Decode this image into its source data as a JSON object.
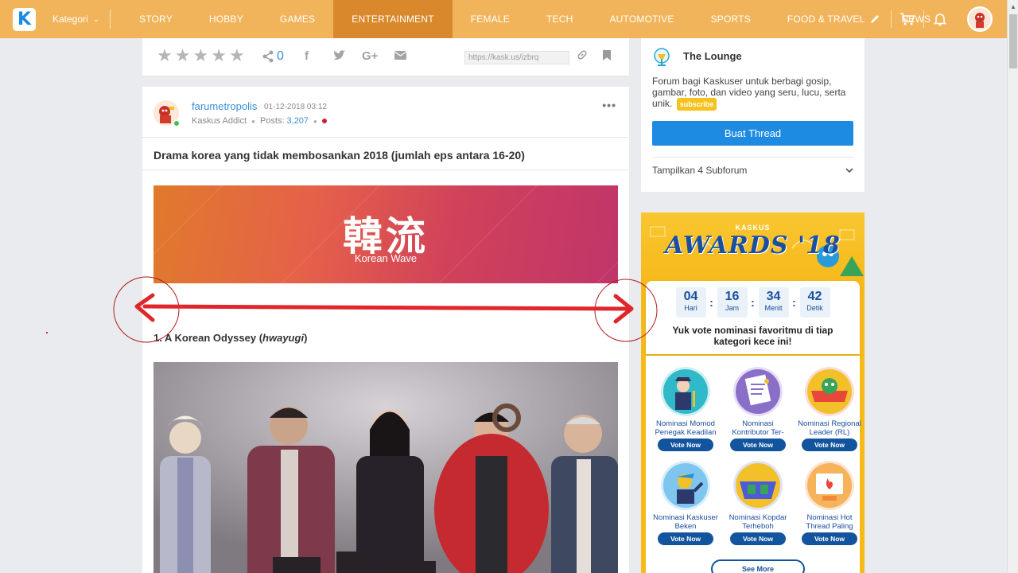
{
  "nav": {
    "logo_letter": "K",
    "kategori_label": "Kategori",
    "items": [
      "STORY",
      "HOBBY",
      "GAMES",
      "ENTERTAINMENT",
      "FEMALE",
      "TECH",
      "AUTOMOTIVE",
      "SPORTS",
      "FOOD & TRAVEL",
      "NEWS"
    ],
    "active_item": "ENTERTAINMENT",
    "accent_color": "#f2b45a",
    "active_color": "#d9892c"
  },
  "actionbar": {
    "share_count": "0",
    "short_url": "https://kask.us/izbrq"
  },
  "post": {
    "username": "farumetropolis",
    "date": "01-12-2018 03:12",
    "rank": "Kaskus Addict",
    "posts_label": "Posts:",
    "posts_value": "3,207",
    "title": "Drama korea yang tidak membosankan 2018 (jumlah eps antara 16-20)",
    "banner_hanja": "韓流",
    "banner_subtitle": "Korean Wave",
    "item_heading_prefix": "1. A Korean Odyssey (",
    "item_heading_italic": "hwayugi",
    "item_heading_suffix": ")"
  },
  "lounge": {
    "name": "The Lounge",
    "description": "Forum bagi Kaskuser untuk berbagi gosip, gambar, foto, dan video yang seru, lucu, serta unik.",
    "subscribe_label": "subscribe",
    "create_thread_label": "Buat Thread",
    "subforum_label": "Tampilkan 4 Subforum"
  },
  "awards": {
    "brand": "KASKUS",
    "title": "AWARDS '18",
    "countdown": [
      {
        "value": "04",
        "label": "Hari"
      },
      {
        "value": "16",
        "label": "Jam"
      },
      {
        "value": "34",
        "label": "Menit"
      },
      {
        "value": "42",
        "label": "Detik"
      }
    ],
    "cta": "Yuk vote nominasi favoritmu di tiap kategori kece ini!",
    "nominations": [
      {
        "label": "Nominasi Momod Penegak Keadilan",
        "color": "#2fb9c9"
      },
      {
        "label": "Nominasi Kontributor Ter-",
        "color": "#8a6fc9"
      },
      {
        "label": "Nominasi Regional Leader (RL)",
        "color": "#e8473c"
      },
      {
        "label": "Nominasi Kaskuser Beken",
        "color": "#2b8fd9"
      },
      {
        "label": "Nominasi Kopdar Terheboh",
        "color": "#4d5bd6"
      },
      {
        "label": "Nominasi Hot Thread Paling",
        "color": "#f08a3a"
      }
    ],
    "vote_label": "Vote Now",
    "see_more_label": "See More"
  },
  "overlay_color": "#e0262a"
}
